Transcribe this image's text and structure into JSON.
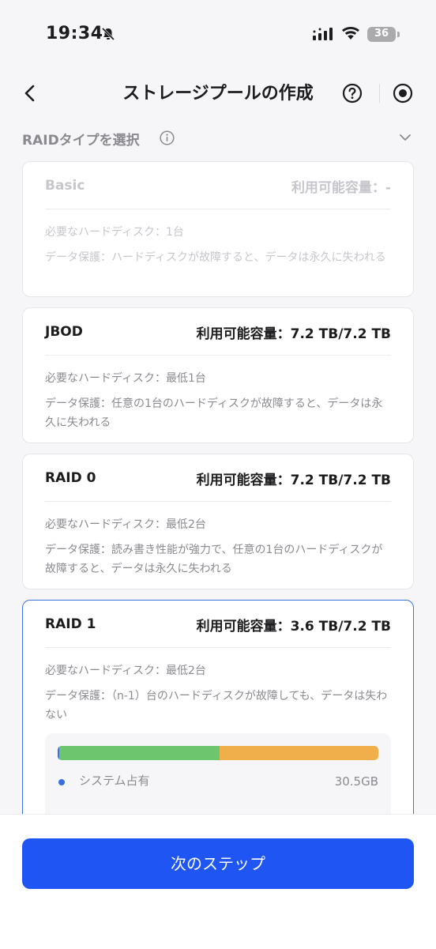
{
  "status_bar": {
    "time": "19:34",
    "battery": "36"
  },
  "nav": {
    "title": "ストレージプールの作成"
  },
  "section": {
    "title": "RAIDタイプを選択"
  },
  "cards": [
    {
      "name": "Basic",
      "capacity": "利用可能容量：-",
      "requirement": "必要なハードディスク：1台",
      "protection": "データ保護：ハードディスクが故障すると、データは永久に失われる"
    },
    {
      "name": "JBOD",
      "capacity": "利用可能容量：7.2 TB/7.2 TB",
      "requirement": "必要なハードディスク：最低1台",
      "protection": "データ保護：任意の1台のハードディスクが故障すると、データは永久に失われる"
    },
    {
      "name": "RAID 0",
      "capacity": "利用可能容量：7.2 TB/7.2 TB",
      "requirement": "必要なハードディスク：最低2台",
      "protection": "データ保護：読み書き性能が強力で、任意の1台のハードディスクが故障すると、データは永久に失われる"
    },
    {
      "name": "RAID 1",
      "capacity": "利用可能容量：3.6 TB/7.2 TB",
      "requirement": "必要なハードディスク：最低2台",
      "protection": "データ保護：（n-1）台のハードディスクが故障しても、データは失わない"
    }
  ],
  "usage": {
    "system_fraction": 0.004,
    "green_fraction": 0.5,
    "orange_fraction": 0.496,
    "legend_label": "システム占有",
    "legend_value": "30.5GB"
  },
  "footer": {
    "next_label": "次のステップ"
  },
  "colors": {
    "accent": "#1f55f2",
    "selected_border": "#3a6fe0",
    "green": "#6dc66d",
    "orange": "#f0af4b"
  }
}
